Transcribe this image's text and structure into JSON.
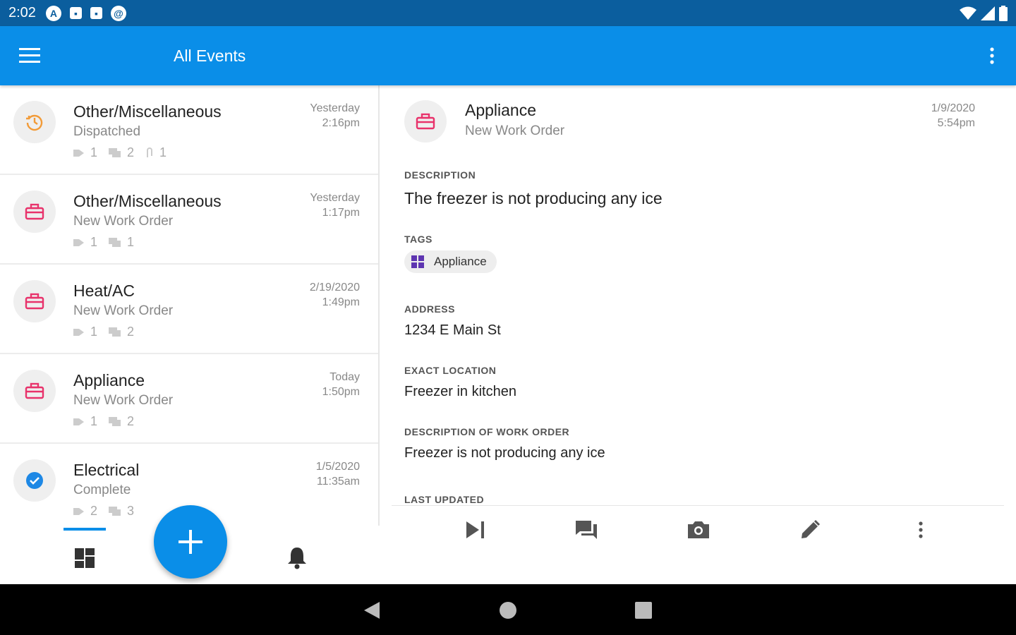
{
  "status_bar": {
    "time": "2:02",
    "icons": [
      "A",
      "▪",
      "▪",
      "@"
    ]
  },
  "app_bar": {
    "title": "All Events"
  },
  "events": [
    {
      "title": "Other/Miscellaneous",
      "status": "Dispatched",
      "date": "Yesterday",
      "time": "2:16pm",
      "tags": "1",
      "comments": "2",
      "attachments": "1",
      "icon": "clock-icon"
    },
    {
      "title": "Other/Miscellaneous",
      "status": "New Work Order",
      "date": "Yesterday",
      "time": "1:17pm",
      "tags": "1",
      "comments": "1",
      "icon": "briefcase-icon"
    },
    {
      "title": "Heat/AC",
      "status": "New Work Order",
      "date": "2/19/2020",
      "time": "1:49pm",
      "tags": "1",
      "comments": "2",
      "icon": "briefcase-icon"
    },
    {
      "title": "Appliance",
      "status": "New Work Order",
      "date": "Today",
      "time": "1:50pm",
      "tags": "1",
      "comments": "2",
      "icon": "briefcase-icon"
    },
    {
      "title": "Electrical",
      "status": "Complete",
      "date": "1/5/2020",
      "time": "11:35am",
      "tags": "2",
      "comments": "3",
      "icon": "check-circle-icon"
    }
  ],
  "detail": {
    "title": "Appliance",
    "status": "New Work Order",
    "date": "1/9/2020",
    "time": "5:54pm",
    "description_label": "DESCRIPTION",
    "description": "The freezer is not producing any ice",
    "tags_label": "TAGS",
    "tag": "Appliance",
    "address_label": "ADDRESS",
    "address": "1234 E Main St",
    "exact_location_label": "EXACT LOCATION",
    "exact_location": "Freezer in kitchen",
    "work_order_label": "DESCRIPTION OF WORK ORDER",
    "work_order": "Freezer is not producing any ice",
    "last_updated_label": "LAST UPDATED"
  },
  "colors": {
    "status_bar": "#0b5e9e",
    "app_bar": "#0a8ee8",
    "dispatched": "#f29b38",
    "new_work_order": "#e8326b",
    "complete": "#1e88e5",
    "tag_icon": "#5e35b1"
  }
}
